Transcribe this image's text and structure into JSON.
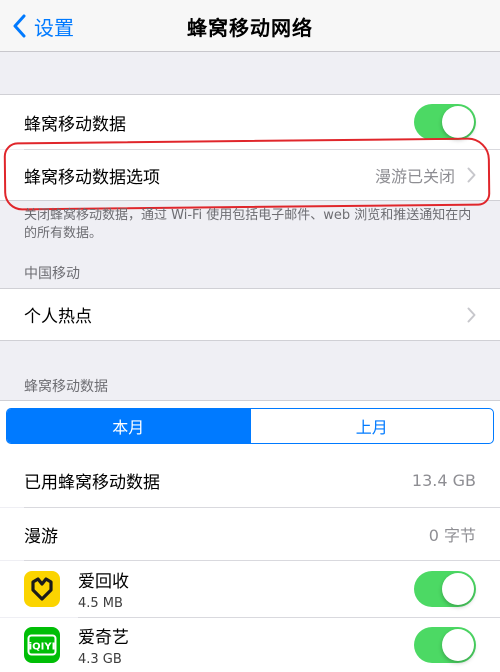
{
  "nav": {
    "back_label": "设置",
    "title": "蜂窝移动网络"
  },
  "cellular_data": {
    "label": "蜂窝移动数据",
    "enabled": true
  },
  "cellular_options": {
    "label": "蜂窝移动数据选项",
    "value": "漫游已关闭"
  },
  "cellular_footer": "关闭蜂窝移动数据，通过 Wi-Fi 使用包括电子邮件、web 浏览和推送通知在内的所有数据。",
  "carrier": {
    "header": "中国移动",
    "hotspot_label": "个人热点"
  },
  "usage": {
    "header": "蜂窝移动数据",
    "segments": [
      "本月",
      "上月"
    ],
    "selected_segment": "本月",
    "used_label": "已用蜂窝移动数据",
    "used_value": "13.4 GB",
    "roaming_label": "漫游",
    "roaming_value": "0 字节"
  },
  "apps": [
    {
      "name": "爱回收",
      "size": "4.5 MB",
      "icon": "aihuishou-app-icon",
      "icon_color": "#fbd400",
      "enabled": true
    },
    {
      "name": "爱奇艺",
      "size": "4.3 GB",
      "icon": "iqiyi-app-icon",
      "icon_color": "#00be06",
      "enabled": true
    }
  ],
  "colors": {
    "accent": "#007aff",
    "toggle_on": "#4cd964",
    "annotation": "#e0262b"
  }
}
